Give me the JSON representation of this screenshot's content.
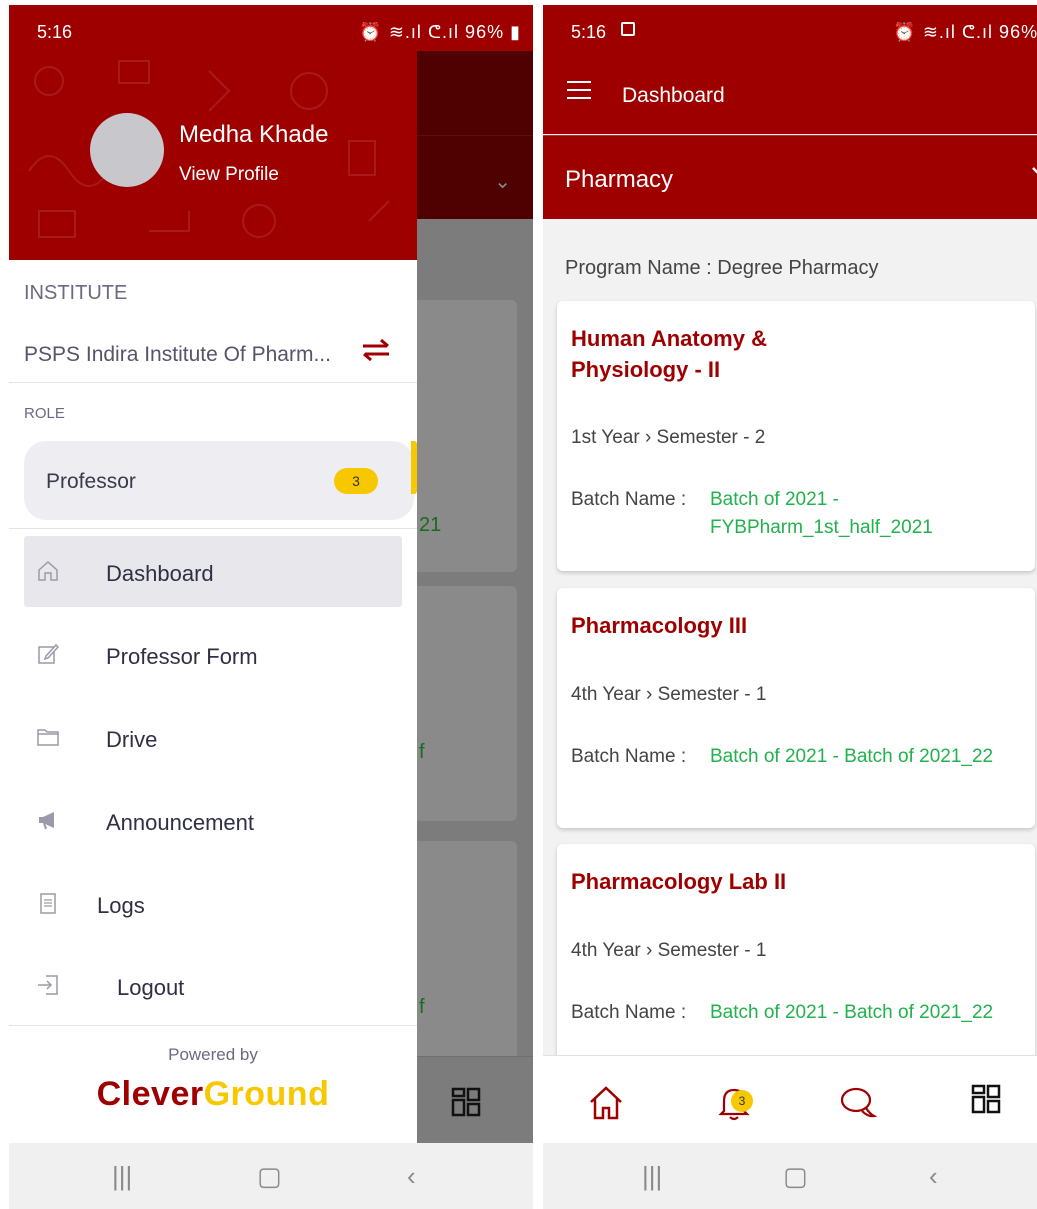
{
  "status_bar": {
    "time": "5:16",
    "right": "⏰ ≋.ıl ᕦ.ıl 96% ▮"
  },
  "drawer": {
    "user_name": "Medha Khade",
    "view_profile": "View Profile",
    "institute_label": "INSTITUTE",
    "institute_name": "PSPS Indira Institute Of Pharm...",
    "role_label": "ROLE",
    "role_name": "Professor",
    "role_badge": "3",
    "menu": [
      {
        "label": "Dashboard",
        "icon": "home-icon"
      },
      {
        "label": "Professor Form",
        "icon": "edit-icon"
      },
      {
        "label": "Drive",
        "icon": "folder-icon"
      },
      {
        "label": "Announcement",
        "icon": "megaphone-icon"
      },
      {
        "label": "Logs",
        "icon": "clipboard-icon"
      },
      {
        "label": "Logout",
        "icon": "logout-icon"
      }
    ],
    "powered_by": "Powered by",
    "brand_part1": "Clever",
    "brand_part2": "Ground"
  },
  "background_peek": {
    "t1": "21",
    "t2": "f",
    "t3": "f"
  },
  "app": {
    "title": "Dashboard",
    "program": "Pharmacy",
    "program_name": "Program Name : Degree Pharmacy",
    "batch_label": "Batch Name :",
    "courses": [
      {
        "title": "Human Anatomy & Physiology - II",
        "year": "1st Year › Semester - 2",
        "batch": "Batch of 2021 - FYBPharm_1st_half_2021"
      },
      {
        "title": "Pharmacology III",
        "year": "4th Year › Semester - 1",
        "batch": "Batch of 2021 - Batch of 2021_22"
      },
      {
        "title": "Pharmacology Lab II",
        "year": "4th Year › Semester - 1",
        "batch": "Batch of 2021 - Batch of 2021_22"
      }
    ],
    "notification_count": "3"
  },
  "nav": {
    "recent": "|||",
    "home": "▢",
    "back": "‹"
  },
  "colors": {
    "primary": "#9e0000",
    "accent": "#f7c800",
    "batch_green": "#22b14c"
  }
}
